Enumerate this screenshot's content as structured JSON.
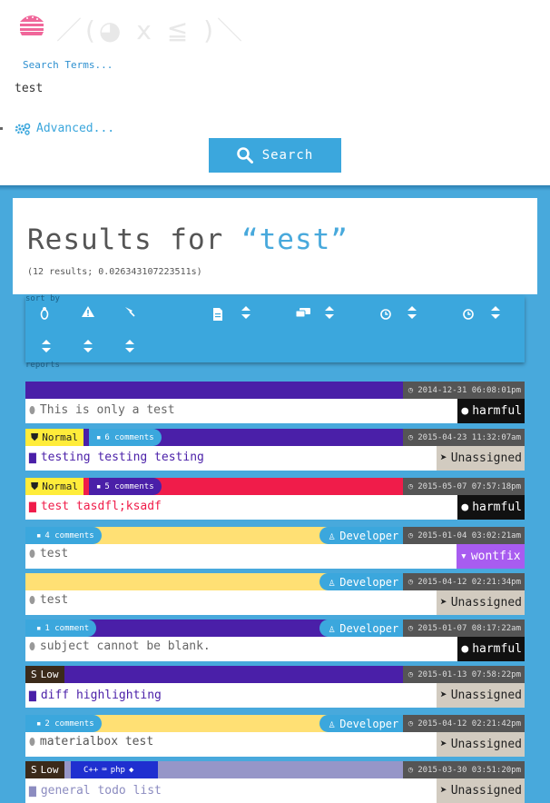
{
  "header": {
    "kaomoji": "／(◕ x ≦ )＼"
  },
  "search": {
    "label": "Search Terms...",
    "value": "test",
    "advanced_label": "Advanced...",
    "button_label": "Search"
  },
  "results": {
    "heading_prefix": "Results for ",
    "query": "“test”",
    "meta": "(12 results; 0.026343107223511s)"
  },
  "sort": {
    "label": "sort by",
    "reports_label": "reports"
  },
  "colors": {
    "purple": "#4a1fa8",
    "yellow": "#ffe074",
    "red": "#f01c4a",
    "gray": "#555555",
    "wontfix": "#a85cf0",
    "harmful": "#111111",
    "unassigned": "#d2cbc0"
  },
  "rows": [
    {
      "title": "This is only a test",
      "date": "2014-12-31 06:08:01pm",
      "status": "harmful"
    },
    {
      "severity": "Normal",
      "comments": "6 comments",
      "title": "testing testing testing",
      "date": "2015-04-23 11:32:07am",
      "status": "Unassigned"
    },
    {
      "severity": "Normal",
      "comments": "5 comments",
      "title": "test tasdfl;ksadf",
      "date": "2015-05-07 07:57:18pm",
      "status": "harmful"
    },
    {
      "comments": "4 comments",
      "role": "Developer",
      "title": "test",
      "date": "2015-01-04 03:02:21am",
      "status": "wontfix"
    },
    {
      "role": "Developer",
      "title": "test",
      "date": "2015-04-12 02:21:34pm",
      "status": "Unassigned"
    },
    {
      "comments": "1 comment",
      "role": "Developer",
      "title": "subject cannot be blank.",
      "date": "2015-01-07 08:17:22am",
      "status": "harmful"
    },
    {
      "severity": "Low",
      "title": "diff highlighting",
      "date": "2015-01-13 07:58:22pm",
      "status": "Unassigned"
    },
    {
      "comments": "2 comments",
      "role": "Developer",
      "title": "materialbox test",
      "date": "2015-04-12 02:21:42pm",
      "status": "Unassigned"
    },
    {
      "severity": "Low",
      "lang1": "C++",
      "lang2": "php",
      "title": "general todo list",
      "date": "2015-03-30 03:51:20pm",
      "status": "Unassigned"
    }
  ]
}
